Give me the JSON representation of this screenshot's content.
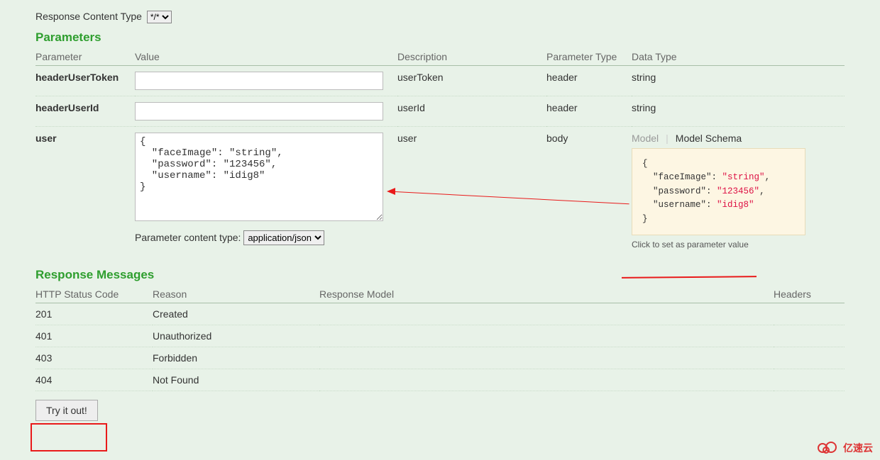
{
  "responseContentType": {
    "label": "Response Content Type",
    "selected": "*/*"
  },
  "parametersHeading": "Parameters",
  "paramHeaders": {
    "parameter": "Parameter",
    "value": "Value",
    "description": "Description",
    "paramType": "Parameter Type",
    "dataType": "Data Type"
  },
  "params": {
    "row0": {
      "name": "headerUserToken",
      "value": "",
      "description": "userToken",
      "paramType": "header",
      "dataType": "string"
    },
    "row1": {
      "name": "headerUserId",
      "value": "",
      "description": "userId",
      "paramType": "header",
      "dataType": "string"
    },
    "row2": {
      "name": "user",
      "body": "{\n  \"faceImage\": \"string\",\n  \"password\": \"123456\",\n  \"username\": \"idig8\"\n}",
      "description": "user",
      "paramType": "body",
      "paramContentTypeLabel": "Parameter content type:",
      "paramContentTypeValue": "application/json",
      "modelTab": "Model",
      "schemaTab": "Model Schema",
      "schemaJson": {
        "faceImage": "string",
        "password": "123456",
        "username": "idig8"
      },
      "clickHint": "Click to set as parameter value"
    }
  },
  "responseMessagesHeading": "Response Messages",
  "respHeaders": {
    "code": "HTTP Status Code",
    "reason": "Reason",
    "model": "Response Model",
    "headers": "Headers"
  },
  "responses": {
    "r0": {
      "code": "201",
      "reason": "Created"
    },
    "r1": {
      "code": "401",
      "reason": "Unauthorized"
    },
    "r2": {
      "code": "403",
      "reason": "Forbidden"
    },
    "r3": {
      "code": "404",
      "reason": "Not Found"
    }
  },
  "tryButton": "Try it out!",
  "logoText": "亿速云"
}
